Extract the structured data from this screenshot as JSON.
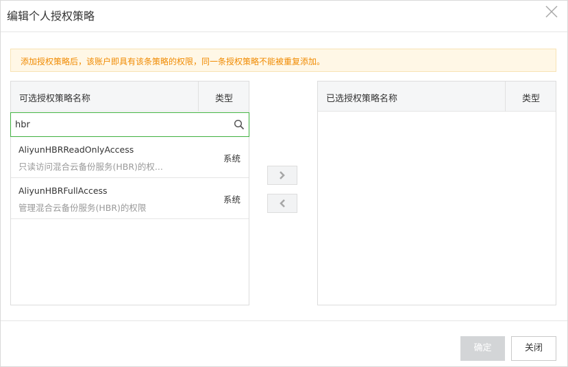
{
  "dialog": {
    "title": "编辑个人授权策略",
    "notice": "添加授权策略后，该账户即具有该条策略的权限，同一条授权策略不能被重复添加。"
  },
  "left_panel": {
    "col_name": "可选授权策略名称",
    "col_type": "类型",
    "search": {
      "value": "hbr",
      "placeholder": ""
    },
    "items": [
      {
        "name": "AliyunHBRReadOnlyAccess",
        "desc": "只读访问混合云备份服务(HBR)的权...",
        "type": "系统"
      },
      {
        "name": "AliyunHBRFullAccess",
        "desc": "管理混合云备份服务(HBR)的权限",
        "type": "系统"
      }
    ]
  },
  "right_panel": {
    "col_name": "已选授权策略名称",
    "col_type": "类型"
  },
  "footer": {
    "confirm_label": "确定",
    "close_label": "关闭"
  },
  "icons": {
    "close": "close-icon",
    "search": "search-icon",
    "move_right": "chevron-right-icon",
    "move_left": "chevron-left-icon"
  },
  "colors": {
    "accent_green": "#3daf3d",
    "notice_text": "#f08a00",
    "notice_bg": "#fff7e6",
    "disabled_button": "#d3d5d7"
  }
}
